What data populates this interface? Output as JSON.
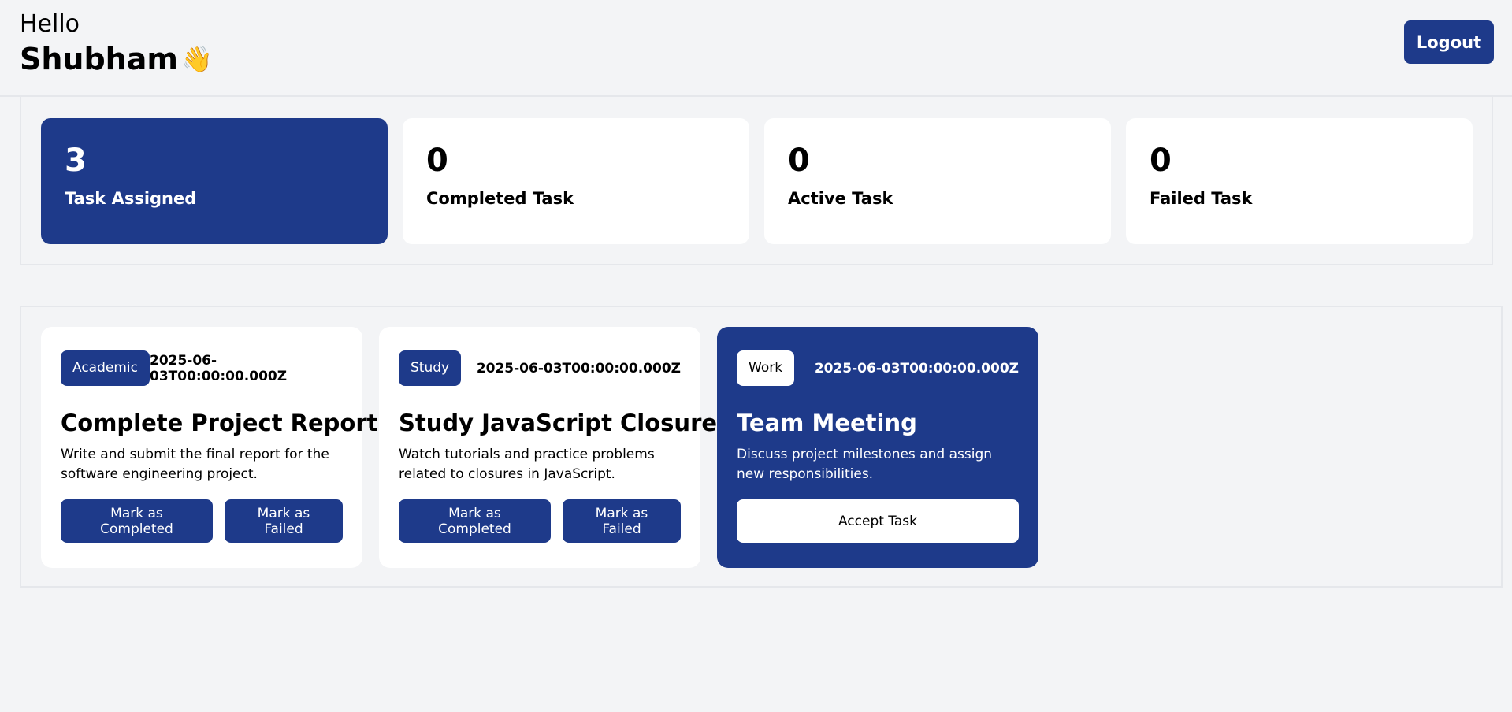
{
  "header": {
    "hello": "Hello",
    "name": "Shubham",
    "wave_emoji": "👋",
    "logout_label": "Logout"
  },
  "stats": [
    {
      "count": "3",
      "label": "Task Assigned"
    },
    {
      "count": "0",
      "label": "Completed Task"
    },
    {
      "count": "0",
      "label": "Active Task"
    },
    {
      "count": "0",
      "label": "Failed Task"
    }
  ],
  "tasks": [
    {
      "category": "Academic",
      "date": "2025-06-03T00:00:00.000Z",
      "title": "Complete Project Report",
      "description": "Write and submit the final report for the software engineering project.",
      "complete_label": "Mark as Completed",
      "fail_label": "Mark as Failed"
    },
    {
      "category": "Study",
      "date": "2025-06-03T00:00:00.000Z",
      "title": "Study JavaScript Closures",
      "description": "Watch tutorials and practice problems related to closures in JavaScript.",
      "complete_label": "Mark as Completed",
      "fail_label": "Mark as Failed"
    },
    {
      "category": "Work",
      "date": "2025-06-03T00:00:00.000Z",
      "title": "Team Meeting",
      "description": "Discuss project milestones and assign new responsibilities.",
      "accept_label": "Accept Task"
    }
  ],
  "colors": {
    "primary": "#1e3a8a",
    "background": "#f3f4f6",
    "card": "#ffffff"
  }
}
